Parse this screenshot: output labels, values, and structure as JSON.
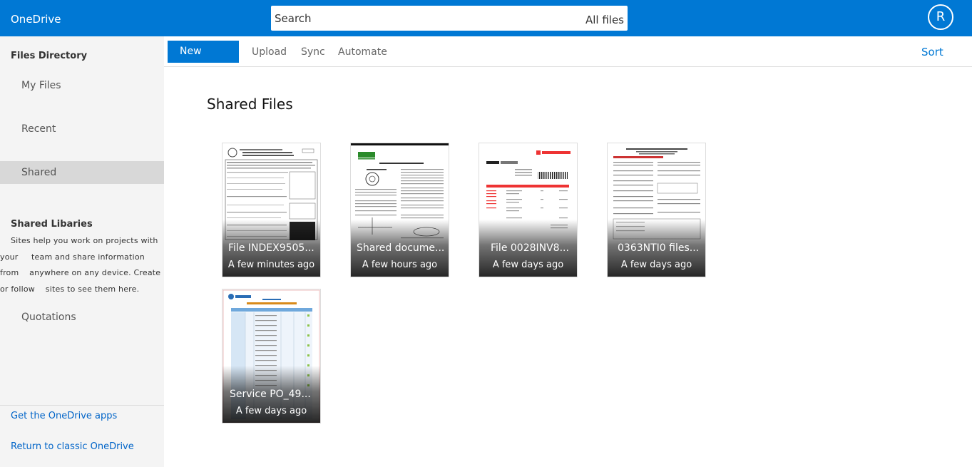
{
  "header": {
    "app_title": "OneDrive",
    "search_placeholder": "Search",
    "search_scope": "All files",
    "avatar_initial": "R"
  },
  "sidebar": {
    "heading": "Files Directory",
    "items": [
      {
        "label": "My Files"
      },
      {
        "label": "Recent"
      },
      {
        "label": "Shared"
      }
    ],
    "libraries_heading": "Shared Libaries",
    "libraries_desc": [
      "Sites help you work on projects with",
      "your     team and share information",
      "from    anywhere on any device. Create",
      "or follow    sites to see them here."
    ],
    "quotations_label": "Quotations",
    "footer_links": [
      {
        "label": "Get the OneDrive apps"
      },
      {
        "label": "Return to classic OneDrive"
      }
    ]
  },
  "toolbar": {
    "new_label": "New",
    "upload_label": "Upload",
    "sync_label": "Sync",
    "automate_label": "Automate",
    "sort_label": "Sort"
  },
  "main": {
    "title": "Shared Files",
    "files": [
      {
        "name": "File INDEX9505...",
        "date": "A few minutes ago"
      },
      {
        "name": "Shared docume...",
        "date": "A few hours ago"
      },
      {
        "name": "File 0028INV8...",
        "date": "A few days ago"
      },
      {
        "name": "0363NTI0 files...",
        "date": "A few days ago"
      },
      {
        "name": "Service PO_49...",
        "date": "A few days ago"
      }
    ]
  },
  "colors": {
    "brand": "#0078d4",
    "link": "#0064c8",
    "sidebar_bg": "#f4f4f4",
    "active_bg": "#d8d8d8"
  }
}
